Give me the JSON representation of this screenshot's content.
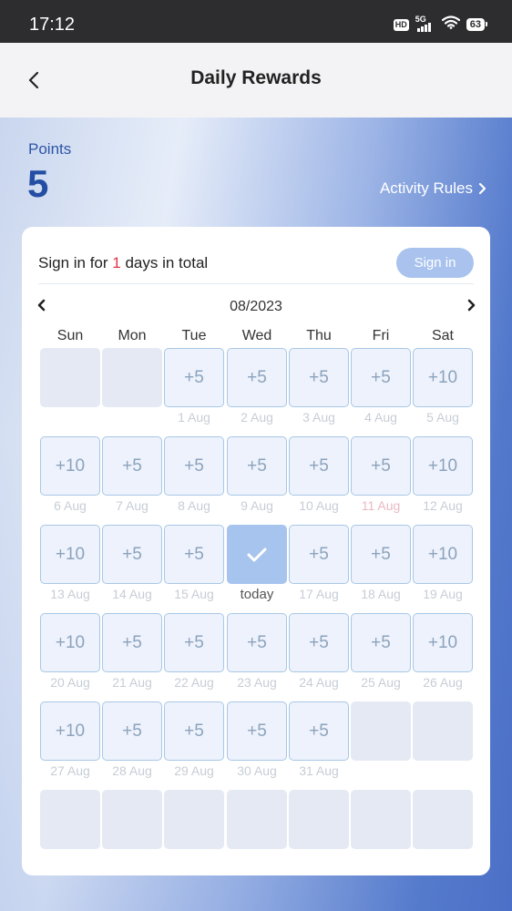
{
  "status_bar": {
    "time": "17:12",
    "hd_badge": "HD",
    "network_type": "5G",
    "battery_level": "63",
    "icons": [
      "hd-icon",
      "signal-5g-icon",
      "wifi-icon",
      "battery-icon"
    ]
  },
  "header": {
    "title": "Daily Rewards",
    "back_icon": "chevron-left-icon"
  },
  "points": {
    "label": "Points",
    "value": "5"
  },
  "activity_rules": {
    "label": "Activity Rules",
    "icon": "chevron-right-icon"
  },
  "sign_in": {
    "text_prefix": "Sign in for ",
    "count": "1",
    "text_suffix": " days in total",
    "button_label": "Sign in"
  },
  "calendar": {
    "month_label": "08/2023",
    "prev_icon": "chevron-left-icon",
    "next_icon": "chevron-right-icon",
    "weekdays": [
      "Sun",
      "Mon",
      "Tue",
      "Wed",
      "Thu",
      "Fri",
      "Sat"
    ],
    "cells": [
      {
        "state": "empty"
      },
      {
        "state": "empty"
      },
      {
        "state": "reward",
        "reward": "+5",
        "date": "1 Aug"
      },
      {
        "state": "reward",
        "reward": "+5",
        "date": "2 Aug"
      },
      {
        "state": "reward",
        "reward": "+5",
        "date": "3 Aug"
      },
      {
        "state": "reward",
        "reward": "+5",
        "date": "4 Aug"
      },
      {
        "state": "reward",
        "reward": "+10",
        "date": "5 Aug"
      },
      {
        "state": "reward",
        "reward": "+10",
        "date": "6 Aug"
      },
      {
        "state": "reward",
        "reward": "+5",
        "date": "7 Aug"
      },
      {
        "state": "reward",
        "reward": "+5",
        "date": "8 Aug"
      },
      {
        "state": "reward",
        "reward": "+5",
        "date": "9 Aug"
      },
      {
        "state": "reward",
        "reward": "+5",
        "date": "10 Aug"
      },
      {
        "state": "reward",
        "reward": "+5",
        "date": "11 Aug",
        "highlight": true
      },
      {
        "state": "reward",
        "reward": "+10",
        "date": "12 Aug"
      },
      {
        "state": "reward",
        "reward": "+10",
        "date": "13 Aug"
      },
      {
        "state": "reward",
        "reward": "+5",
        "date": "14 Aug"
      },
      {
        "state": "reward",
        "reward": "+5",
        "date": "15 Aug"
      },
      {
        "state": "checked",
        "date": "today",
        "icon": "checkmark-icon"
      },
      {
        "state": "reward",
        "reward": "+5",
        "date": "17 Aug"
      },
      {
        "state": "reward",
        "reward": "+5",
        "date": "18 Aug"
      },
      {
        "state": "reward",
        "reward": "+10",
        "date": "19 Aug"
      },
      {
        "state": "reward",
        "reward": "+10",
        "date": "20 Aug"
      },
      {
        "state": "reward",
        "reward": "+5",
        "date": "21 Aug"
      },
      {
        "state": "reward",
        "reward": "+5",
        "date": "22 Aug"
      },
      {
        "state": "reward",
        "reward": "+5",
        "date": "23 Aug"
      },
      {
        "state": "reward",
        "reward": "+5",
        "date": "24 Aug"
      },
      {
        "state": "reward",
        "reward": "+5",
        "date": "25 Aug"
      },
      {
        "state": "reward",
        "reward": "+10",
        "date": "26 Aug"
      },
      {
        "state": "reward",
        "reward": "+10",
        "date": "27 Aug"
      },
      {
        "state": "reward",
        "reward": "+5",
        "date": "28 Aug"
      },
      {
        "state": "reward",
        "reward": "+5",
        "date": "29 Aug"
      },
      {
        "state": "reward",
        "reward": "+5",
        "date": "30 Aug"
      },
      {
        "state": "reward",
        "reward": "+5",
        "date": "31 Aug"
      },
      {
        "state": "empty"
      },
      {
        "state": "empty"
      },
      {
        "state": "empty"
      },
      {
        "state": "empty"
      },
      {
        "state": "empty"
      },
      {
        "state": "empty"
      },
      {
        "state": "empty"
      },
      {
        "state": "empty"
      },
      {
        "state": "empty"
      }
    ]
  },
  "colors": {
    "accent_blue": "#244ea3",
    "sign_in_button": "#a9c3ee",
    "highlight_red": "#e0364b",
    "reward_border": "#a8c7e6",
    "checked_cell": "#a7c4ef"
  }
}
